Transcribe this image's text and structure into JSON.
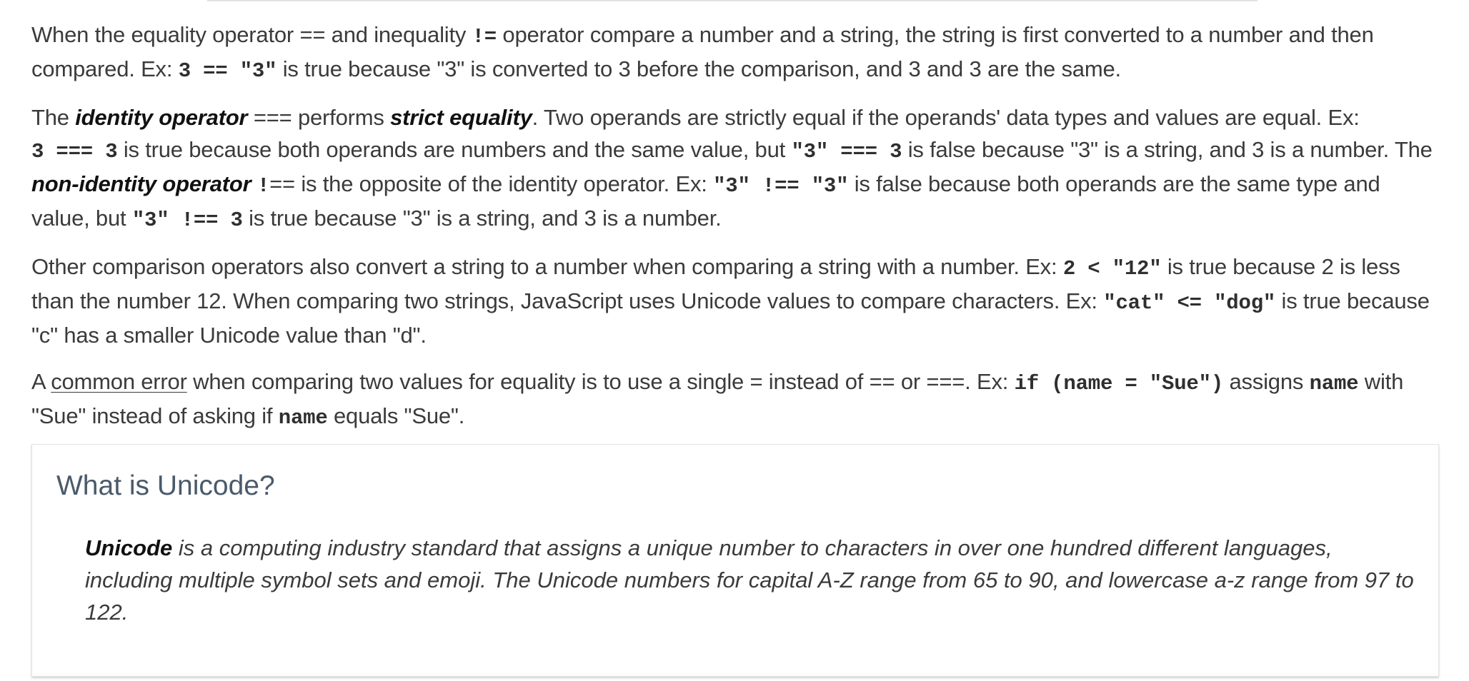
{
  "p1": {
    "t1": "When the equality operator == and inequality ",
    "c1": "!=",
    "t2": " operator compare a number and a string, the string is first converted to a number and then compared. Ex: ",
    "c2": "3 == \"3\"",
    "t3": " is true because \"3\" is converted to 3 before the comparison, and 3 and 3 are the same."
  },
  "p2": {
    "t1": "The ",
    "b1": "identity operator",
    "t2": " === performs ",
    "b2": "strict equality",
    "t3": ". Two operands are strictly equal if the operands' data types and values are equal. Ex: ",
    "c1": "3 === 3",
    "t4": " is true because both operands are numbers and the same value, but ",
    "c2": "\"3\" === 3",
    "t5": " is false because \"3\" is a string, and 3 is a number. The ",
    "b3": "non-identity operator",
    "t6": " ",
    "c3": "!",
    "t7": "== is the opposite of the identity operator. Ex: ",
    "c4": "\"3\" !== \"3\"",
    "t8": " is false because both operands are the same type and value, but ",
    "c5": "\"3\" !== 3",
    "t9": " is true because \"3\" is a string, and 3 is a number."
  },
  "p3": {
    "t1": "Other comparison operators also convert a string to a number when comparing a string with a number. Ex: ",
    "c1": "2 < \"12\"",
    "t2": " is true because 2 is less than the number 12. When comparing two strings, JavaScript uses Unicode values to compare characters. Ex: ",
    "c2": "\"cat\" <= \"dog\"",
    "t3": " is true because \"c\" has a smaller Unicode value than \"d\"."
  },
  "p4": {
    "t1": "A ",
    "link": "common error",
    "t2": " when comparing two values for equality is to use a single = instead of == or ===. Ex: ",
    "c1": "if (name = \"Sue\")",
    "t3": " assigns ",
    "c2": "name",
    "t4": " with \"Sue\" instead of asking if ",
    "c3": "name",
    "t5": " equals \"Sue\"."
  },
  "note": {
    "title": "What is Unicode?",
    "term": "Unicode",
    "text": " is a computing industry standard that assigns a unique number to characters in over one hundred different languages, including multiple symbol sets and emoji. The Unicode numbers for capital A-Z range from 65 to 90, and lowercase a-z range from 97 to 122."
  }
}
